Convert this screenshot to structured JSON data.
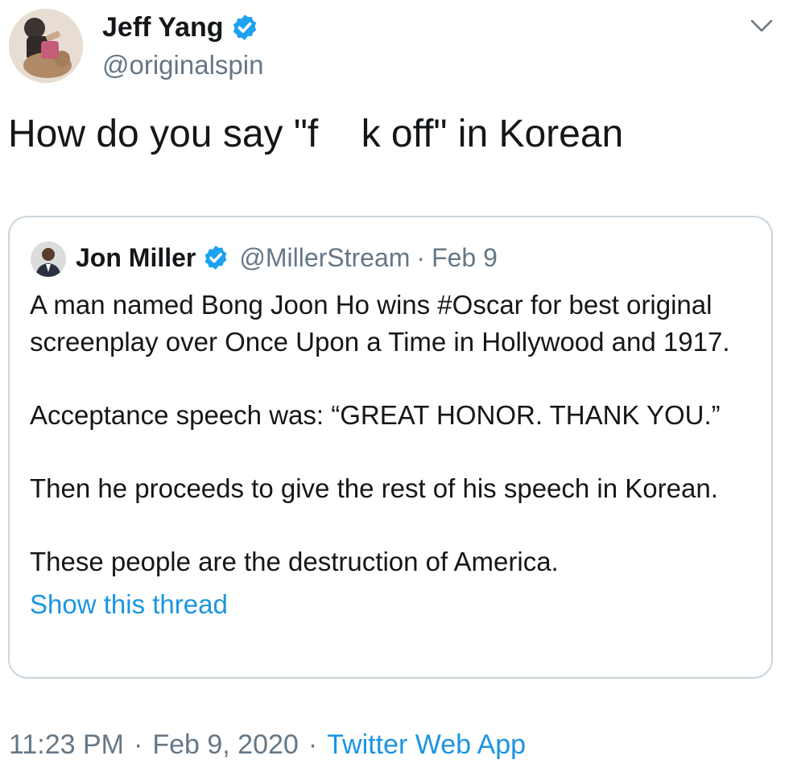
{
  "tweet": {
    "author_name": "Jeff Yang",
    "author_handle": "@originalspin",
    "text": "How do you say \"f    k off\" in Korean",
    "time": "11:23 PM",
    "date": "Feb 9, 2020",
    "source": "Twitter Web App",
    "separator": "·"
  },
  "quoted": {
    "author_name": "Jon Miller",
    "author_handle": "@MillerStream",
    "date": "Feb 9",
    "separator": "·",
    "paragraphs": [
      "A man named Bong Joon Ho wins #Oscar for best original screenplay over Once Upon a Time in Hollywood and 1917.",
      "Acceptance speech was: “GREAT HONOR. THANK YOU.”",
      "Then he proceeds to give the rest of his speech in Korean.",
      "These people are the destruction of America."
    ],
    "show_thread": "Show this thread"
  },
  "colors": {
    "verified": "#1da1f2",
    "link": "#1b95e0",
    "secondary_text": "#657786",
    "border": "#ccd6dd"
  },
  "icons": [
    "verified-badge-icon",
    "chevron-down-icon"
  ]
}
